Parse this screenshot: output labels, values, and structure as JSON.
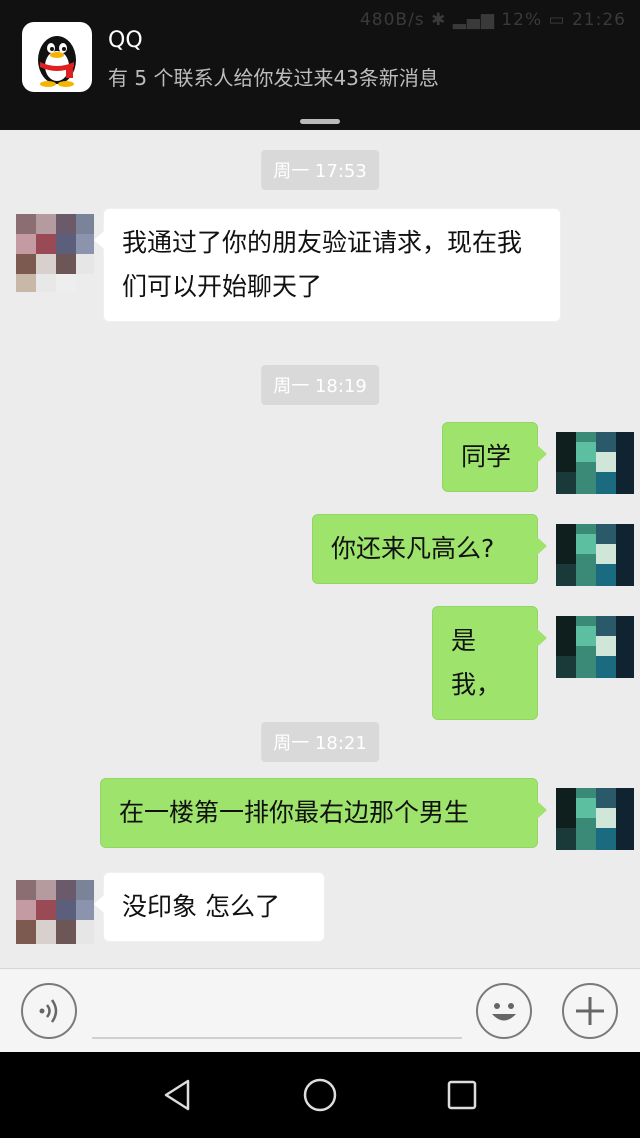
{
  "notification": {
    "app_name": "QQ",
    "message": "有 5 个联系人给你发过来43条新消息",
    "status_text": "480B/s ✱ ▂▄▆ 12% ▭ 21:26"
  },
  "chat": {
    "timestamps": [
      "周一 17:53",
      "周一 18:19",
      "周一 18:21"
    ],
    "messages": [
      {
        "side": "in",
        "text": "我通过了你的朋友验证请求，现在我们可以开始聊天了"
      },
      {
        "side": "out",
        "text": "同学"
      },
      {
        "side": "out",
        "text": "你还来凡高么?"
      },
      {
        "side": "out",
        "text": "是我，"
      },
      {
        "side": "out",
        "text": "在一楼第一排你最右边那个男生"
      },
      {
        "side": "in",
        "text": "没印象  怎么了"
      }
    ]
  },
  "input_bar": {
    "voice_icon": "voice-icon",
    "emoji_icon": "emoji-icon",
    "more_icon": "plus-icon",
    "text_value": ""
  },
  "navigation": {
    "icons": [
      "back-icon",
      "home-icon",
      "recents-icon"
    ]
  },
  "colors": {
    "background": "#ececec",
    "outgoing_bubble": "#9de36c",
    "incoming_bubble": "#ffffff",
    "timestamp_bg": "#d9d9d9",
    "banner_bg": "#111111"
  }
}
